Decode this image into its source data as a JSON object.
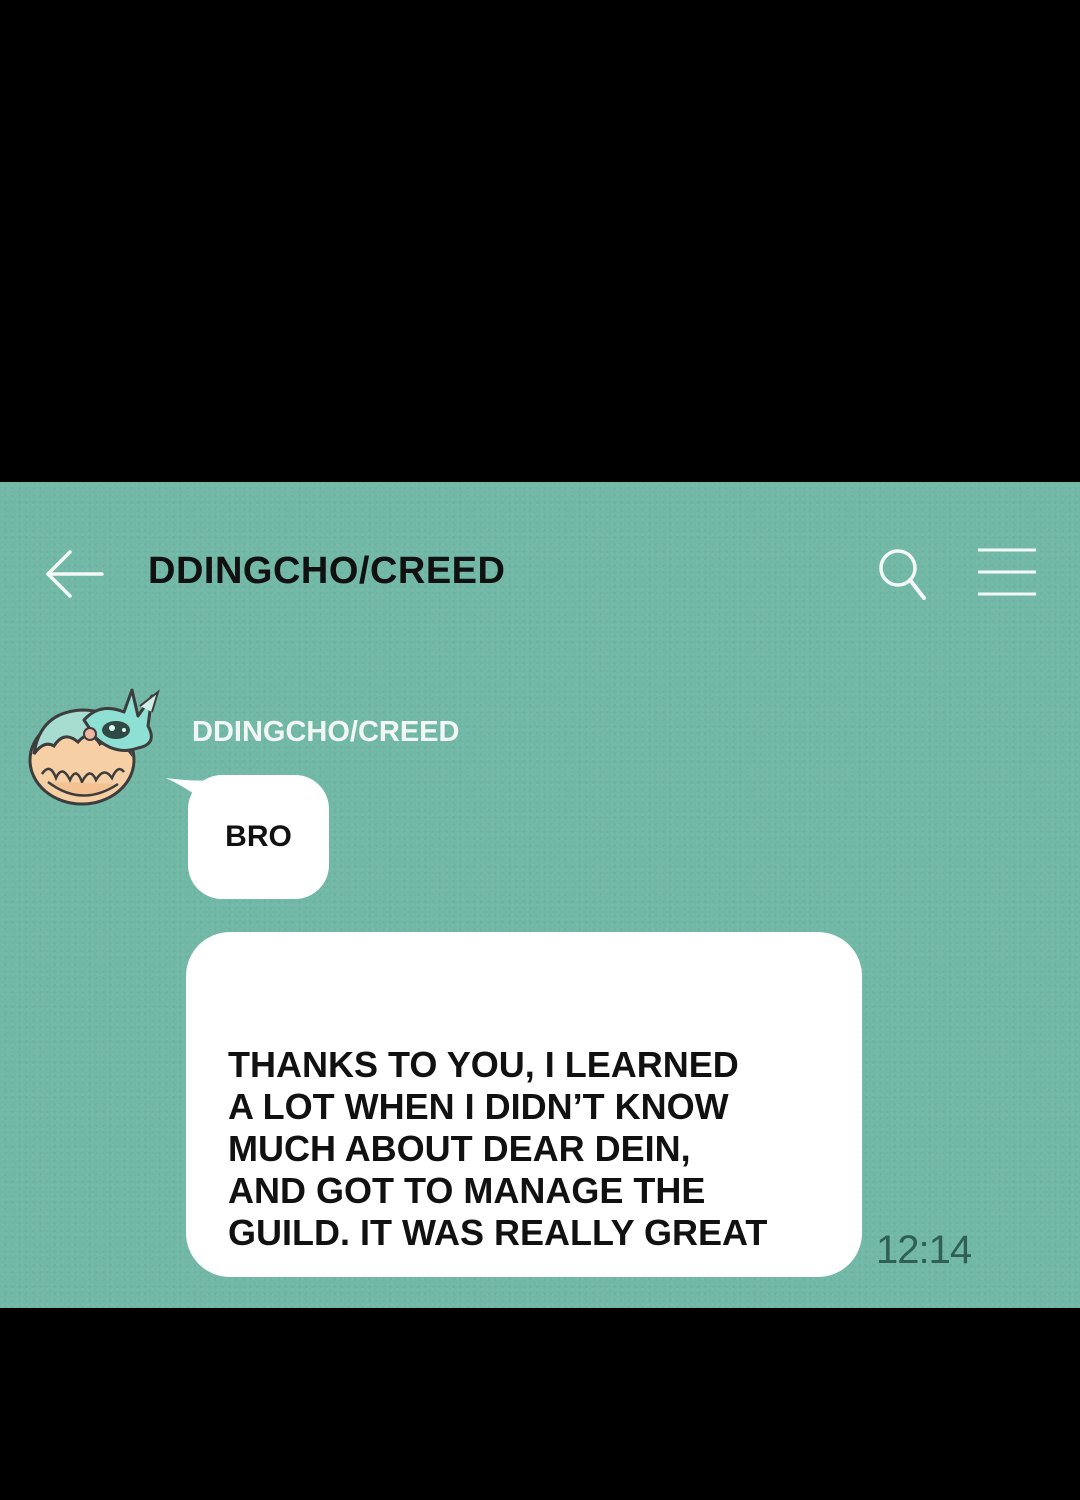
{
  "header": {
    "back_icon": "arrow-left-icon",
    "title": "DDINGCHO/CREED",
    "search_icon": "search-icon",
    "menu_icon": "hamburger-menu-icon"
  },
  "messages": [
    {
      "sender": "DDINGCHO/CREED",
      "avatar_icon": "character-avatar",
      "text": "BRO"
    },
    {
      "text": "THANKS TO YOU, I LEARNED\nA LOT WHEN I DIDN’T KNOW\nMUCH ABOUT DEAR DEIN,\nAND GOT TO MANAGE THE\nGUILD. IT WAS REALLY GREAT",
      "time": "12:14"
    }
  ],
  "colors": {
    "chat_background": "#72b8a6",
    "bubble": "#ffffff",
    "letterbox": "#000000",
    "title_text": "#111111",
    "sender_name": "#f2f7f5",
    "timestamp": "#2f5f56"
  }
}
